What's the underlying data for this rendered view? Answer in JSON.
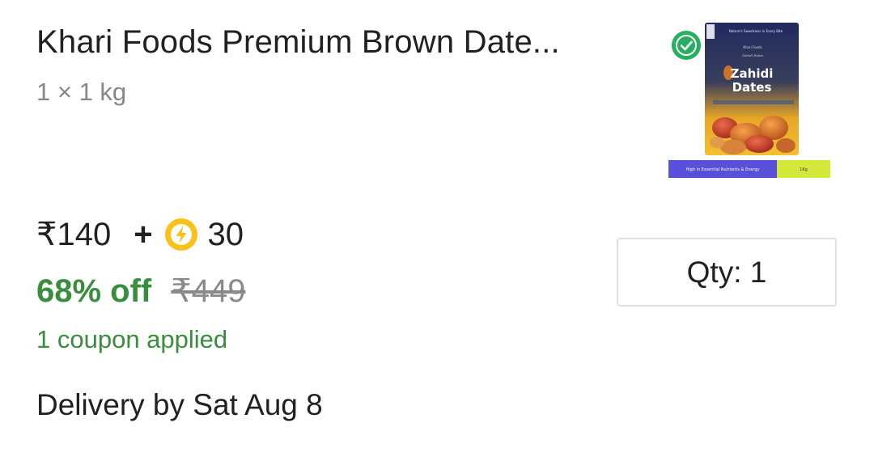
{
  "product": {
    "title": "Khari Foods Premium Brown Date...",
    "variant": "1 × 1 kg",
    "image": {
      "brand_tagline": "Nature's Sweetness in Every Bite",
      "brand_name": "Khari Foods",
      "logo_text": "Zahidi Dates",
      "name_line1": "Zahidi",
      "name_line2": "Dates",
      "footer_left": "High in Essential Nutrients & Energy",
      "footer_right": "1Kg"
    }
  },
  "pricing": {
    "price": "₹140",
    "plus": "+",
    "coins": "30",
    "discount": "68% off",
    "mrp": "₹449",
    "coupon_text": "1 coupon applied"
  },
  "quantity": {
    "label": "Qty: 1"
  },
  "delivery": {
    "text": "Delivery by Sat Aug 8"
  },
  "colors": {
    "discount_green": "#388e3c",
    "coin_yellow": "#f9c11a",
    "text_primary": "#212121",
    "text_secondary": "#878787",
    "assured_badge": "#27ae60"
  },
  "icons": {
    "coin": "lightning-coin-icon",
    "assured": "assured-check-badge-icon"
  }
}
